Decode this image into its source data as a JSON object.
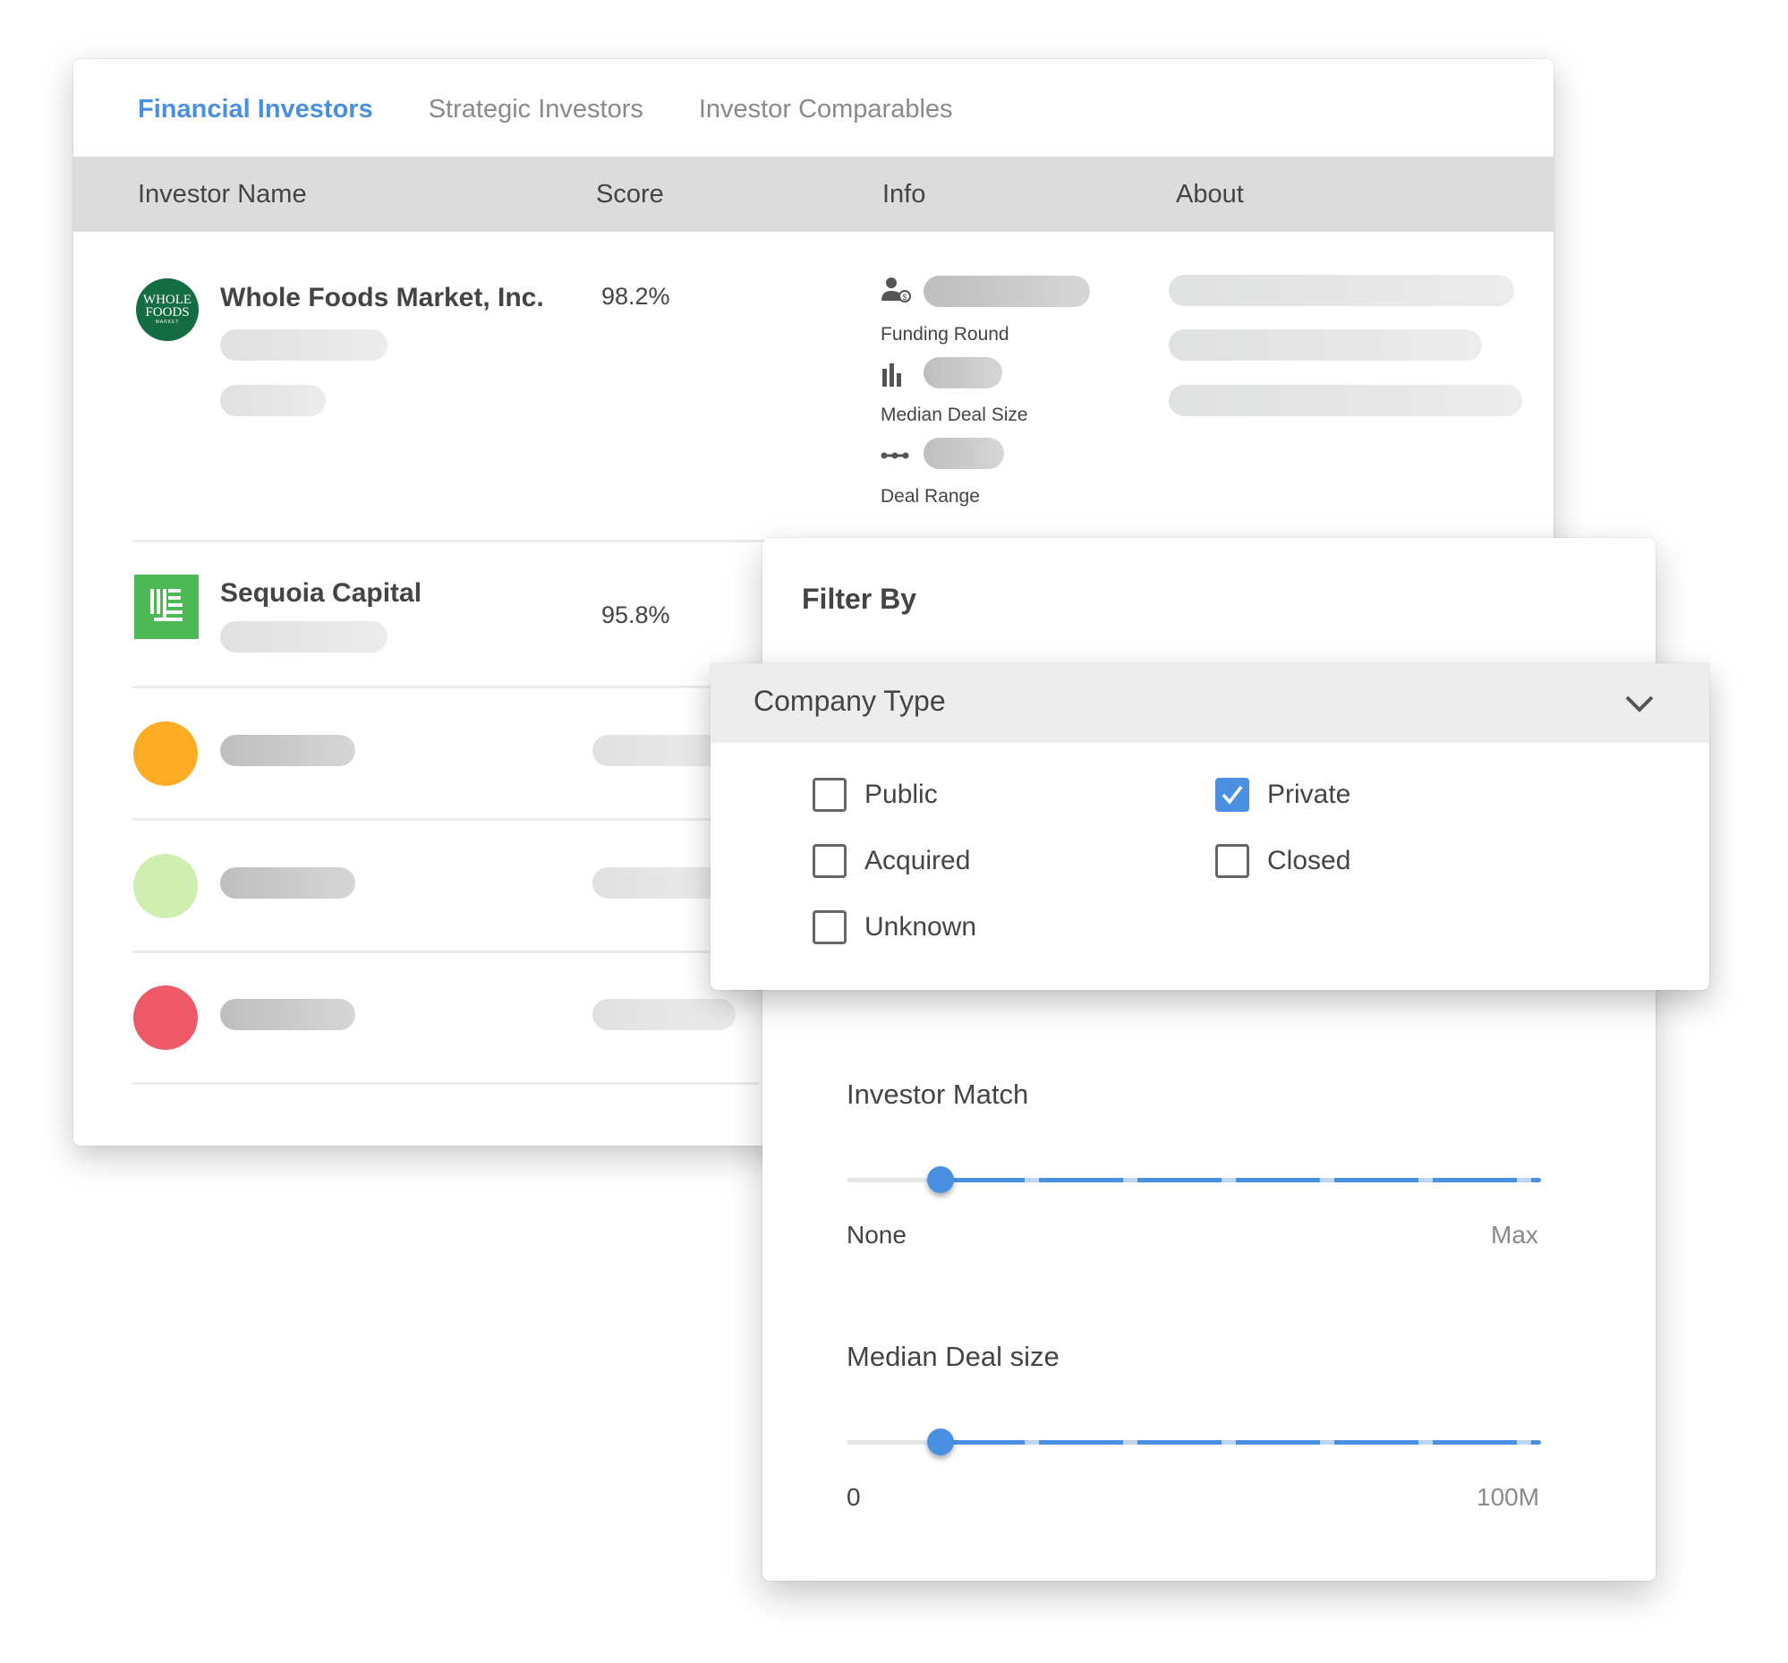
{
  "tabs": [
    {
      "label": "Financial Investors",
      "active": true
    },
    {
      "label": "Strategic Investors",
      "active": false
    },
    {
      "label": "Investor Comparables",
      "active": false
    }
  ],
  "table": {
    "columns": [
      "Investor Name",
      "Score",
      "Info",
      "About"
    ],
    "rows": [
      {
        "name": "Whole Foods Market, Inc.",
        "score": "98.2%",
        "logo": {
          "line1": "WHOLE",
          "line2": "FOODS",
          "line3": "MARKET",
          "color": "#146c43"
        }
      },
      {
        "name": "Sequoia Capital",
        "score": "95.8%",
        "logo": {
          "color": "#4cb856"
        }
      },
      {
        "name": "",
        "score": "",
        "avatar_color": "#fdad25"
      },
      {
        "name": "",
        "score": "",
        "avatar_color": "#cfeeaf"
      },
      {
        "name": "",
        "score": "",
        "avatar_color": "#ee5967"
      }
    ],
    "info_labels": {
      "funding_round": "Funding Round",
      "median_deal_size": "Median Deal Size",
      "deal_range": "Deal Range"
    }
  },
  "filter": {
    "title": "Filter By",
    "company_type": {
      "title": "Company Type",
      "options": [
        {
          "label": "Public",
          "checked": false
        },
        {
          "label": "Private",
          "checked": true
        },
        {
          "label": "Acquired",
          "checked": false
        },
        {
          "label": "Closed",
          "checked": false
        },
        {
          "label": "Unknown",
          "checked": false
        }
      ]
    },
    "investor_match": {
      "label": "Investor Match",
      "min_label": "None",
      "max_label": "Max",
      "value_fraction": 0.135
    },
    "median_deal_size": {
      "label": "Median Deal size",
      "min_label": "0",
      "max_label": "100M",
      "value_fraction": 0.135
    }
  },
  "colors": {
    "accent": "#4a90e2",
    "header_bg": "#dcdcdc",
    "dropdown_header_bg": "#ededed"
  }
}
